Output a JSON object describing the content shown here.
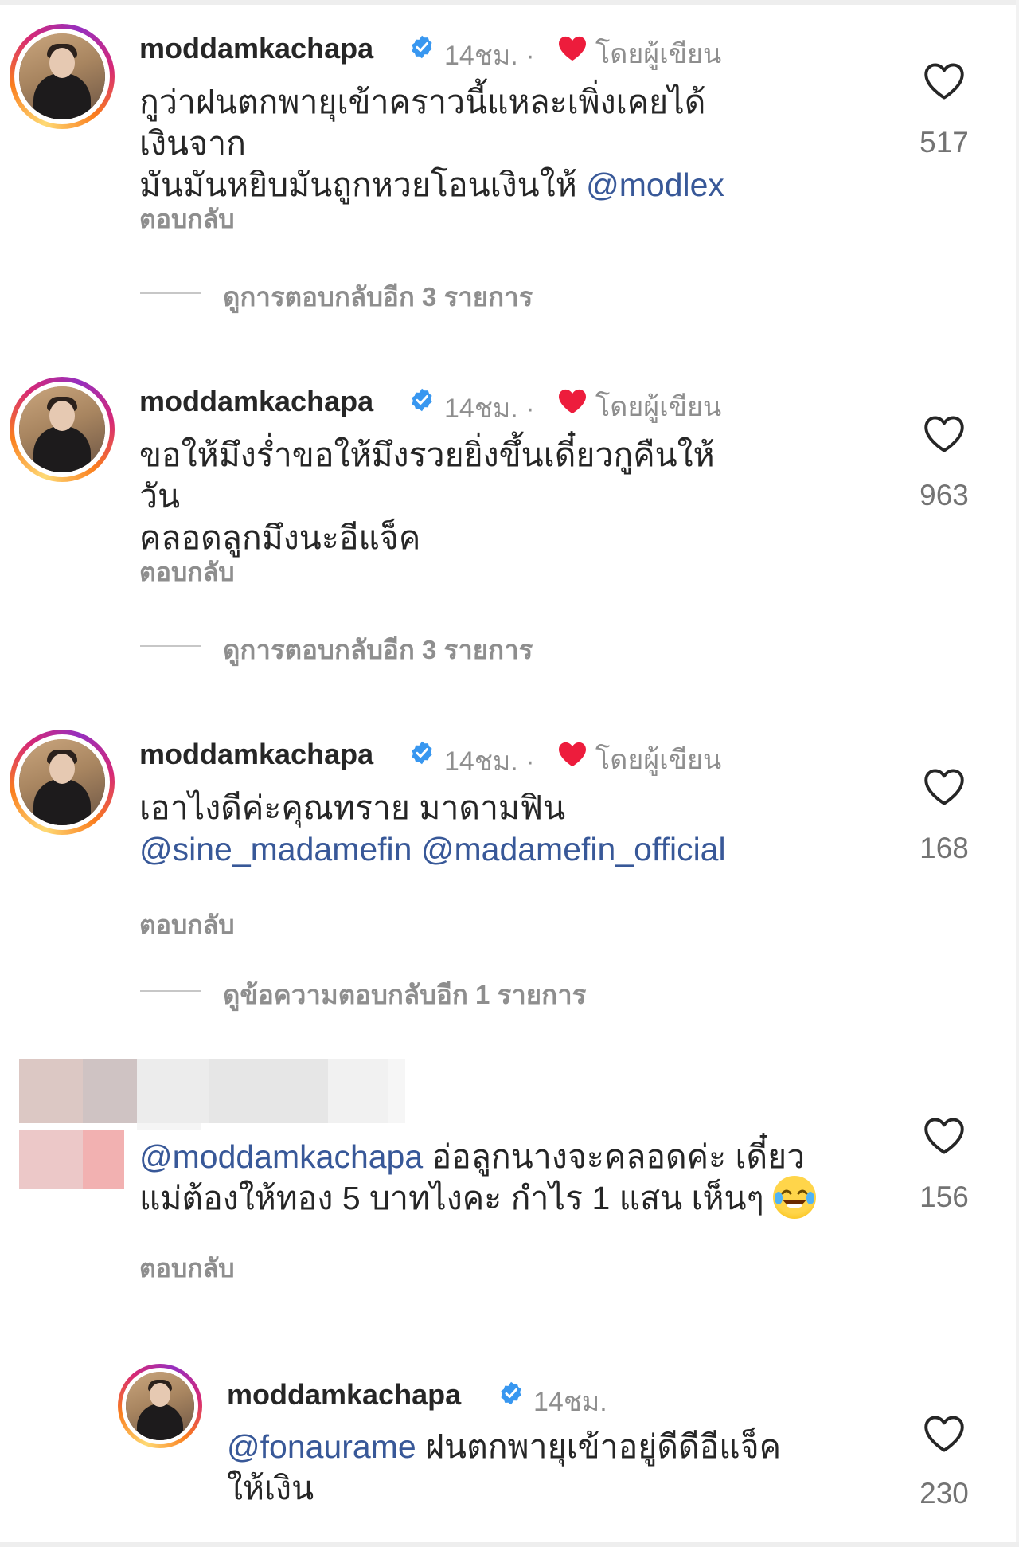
{
  "comments": [
    {
      "username": "moddamkachapa",
      "time": "14ชม.",
      "separator": "·",
      "by_author": "โดยผู้เขียน",
      "line1": "กูว่าฝนตกพายุเข้าคราวนี้แหละเพิ่งเคยได้เงินจาก",
      "line2": "มันมันหยิบมันถูกหวยโอนเงินให้ ",
      "mention": "@modlex",
      "reply": "ตอบกลับ",
      "likes": "517",
      "view_replies": "ดูการตอบกลับอีก 3 รายการ"
    },
    {
      "username": "moddamkachapa",
      "time": "14ชม.",
      "separator": "·",
      "by_author": "โดยผู้เขียน",
      "line1": "ขอให้มึงร่ำขอให้มึงรวยยิ่งขึ้นเดี๋ยวกูคืนให้วัน",
      "line2": "คลอดลูกมึงนะอีแจ็ค",
      "reply": "ตอบกลับ",
      "likes": "963",
      "view_replies": "ดูการตอบกลับอีก 3 รายการ"
    },
    {
      "username": "moddamkachapa",
      "time": "14ชม.",
      "separator": "·",
      "by_author": "โดยผู้เขียน",
      "line1": "เอาไงดีค่ะคุณทราย มาดามฟิน",
      "mention_a": "@sine_madamefin",
      "mention_b": "@madamefin_official",
      "reply": "ตอบกลับ",
      "likes": "168",
      "view_replies": "ดูข้อความตอบกลับอีก 1 รายการ"
    },
    {
      "mention": "@moddamkachapa",
      "line1_rest": " อ่อลูกนางจะคลอดค่ะ เดี๋ยว",
      "line2": "แม่ต้องให้ทอง 5 บาทไงคะ กำไร 1 แสน เห็นๆ ",
      "emoji": "face-with-tears-of-joy",
      "reply": "ตอบกลับ",
      "likes": "156"
    },
    {
      "username": "moddamkachapa",
      "time": "14ชม.",
      "mention": "@fonaurame",
      "line1_rest": " ฝนตกพายุเข้าอยู่ดีดีอีแจ็ค",
      "line2": "ให้เงิน",
      "likes": "230"
    }
  ],
  "colors": {
    "mention": "#385898",
    "muted": "#8e8e8e",
    "heart_red": "#ed1c3c",
    "verified_blue": "#3897f0"
  }
}
